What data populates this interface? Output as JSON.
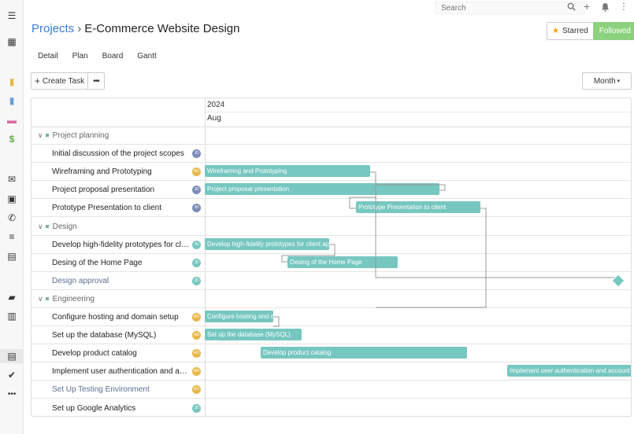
{
  "topbar": {
    "search_placeholder": "Search",
    "icons": [
      "search-icon",
      "plus-icon",
      "bell-icon",
      "kebab-icon"
    ]
  },
  "sidebar": {
    "icons": [
      "menu-icon",
      "dashboard-icon",
      "note-icon",
      "contact-icon",
      "card-icon",
      "dollar-icon",
      "mail-icon",
      "calendar-check-icon",
      "phone-icon",
      "list-icon",
      "calendar-icon",
      "briefcase-icon",
      "book-icon",
      "tasks-icon",
      "check-icon",
      "more-icon"
    ]
  },
  "header": {
    "breadcrumb_root": "Projects",
    "breadcrumb_sep": "›",
    "title": "E-Commerce Website Design",
    "starred_label": "Starred",
    "followed_label": "Followed"
  },
  "tabs": [
    "Detail",
    "Plan",
    "Board",
    "Gantt"
  ],
  "toolbar": {
    "create_label": "Create Task",
    "more_label": "•••",
    "view_label": "Month"
  },
  "timeline": {
    "year": "2024",
    "month": "Aug"
  },
  "rows": [
    {
      "type": "group",
      "label": "Project planning"
    },
    {
      "type": "task",
      "label": "Initial discussion of the project scopes",
      "avatar": "JD",
      "avatar_color": "#7a8cb8"
    },
    {
      "type": "task",
      "label": "Wireframing and Prototyping",
      "avatar": "AD",
      "avatar_color": "#e8b84a",
      "bar": "Wireframing and Prototyping"
    },
    {
      "type": "task",
      "label": "Project proposal presentation",
      "avatar": "JD",
      "avatar_color": "#7a8cb8",
      "bar": "Project proposal presentation"
    },
    {
      "type": "task",
      "label": "Prototype Presentation to client",
      "avatar": "JD",
      "avatar_color": "#7a8cb8",
      "bar": "Prototype Presentation to client"
    },
    {
      "type": "group",
      "label": "Design"
    },
    {
      "type": "task",
      "label": "Develop high-fidelity prototypes for client approval",
      "avatar": "JD",
      "avatar_color": "#76c7c0",
      "bar": "Develop high-fidelity prototypes for client approval"
    },
    {
      "type": "task",
      "label": "Desing of the Home Page",
      "avatar": "JD",
      "avatar_color": "#76c7c0",
      "bar": "Desing of the Home Page"
    },
    {
      "type": "task",
      "label": "Design approval",
      "avatar": "JD",
      "avatar_color": "#76c7c0",
      "muted": true
    },
    {
      "type": "group",
      "label": "Engineering"
    },
    {
      "type": "task",
      "label": "Configure hosting and domain setup",
      "avatar": "AD",
      "avatar_color": "#e8b84a",
      "bar": "Configure hosting and domain setup"
    },
    {
      "type": "task",
      "label": "Set up the database (MySQL)",
      "avatar": "AD",
      "avatar_color": "#e8b84a",
      "bar": "Set up the database (MySQL)"
    },
    {
      "type": "task",
      "label": "Develop product catalog",
      "avatar": "AD",
      "avatar_color": "#e8b84a",
      "bar": "Develop product catalog"
    },
    {
      "type": "task",
      "label": "Implement user authentication and account management",
      "avatar": "AD",
      "avatar_color": "#e8b84a",
      "bar": "Implement user authentication and account"
    },
    {
      "type": "task",
      "label": "Set Up Testing Environment",
      "avatar": "AD",
      "avatar_color": "#e8b84a",
      "muted": true
    },
    {
      "type": "task",
      "label": "Set up Google Analytics",
      "avatar": "JD",
      "avatar_color": "#76c7c0"
    }
  ],
  "colors": {
    "accent": "#3a7bd5",
    "bar": "#76c7c0",
    "followed": "#8cd17d",
    "star": "#f0a400"
  }
}
